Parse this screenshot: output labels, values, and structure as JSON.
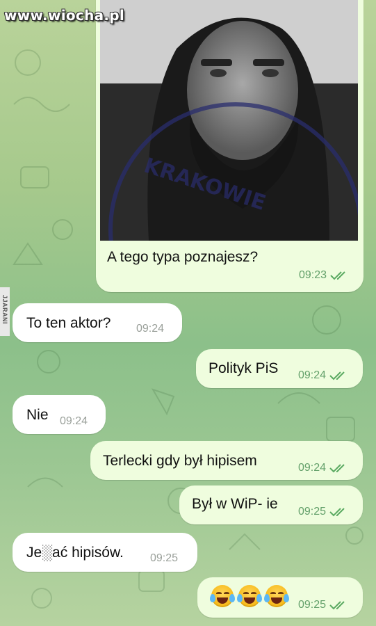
{
  "watermark": "www.wiocha.pl",
  "side_watermark": "JJARANI",
  "messages": [
    {
      "text": "A tego typa poznajesz?",
      "time": "09:23",
      "read": true
    },
    {
      "text": "To ten aktor?",
      "time": "09:24"
    },
    {
      "text": "Polityk PiS",
      "time": "09:24",
      "read": true
    },
    {
      "text": "Nie",
      "time": "09:24"
    },
    {
      "text": "Terlecki gdy był hipisem",
      "time": "09:24",
      "read": true
    },
    {
      "text": "Był w WiP- ie",
      "time": "09:25",
      "read": true
    },
    {
      "text": "Je░ać hipisów.",
      "time": "09:25"
    },
    {
      "text": "😂😂😂",
      "time": "09:25",
      "read": true
    }
  ],
  "photo": {
    "stamp_text": "KRAKOWIE"
  },
  "colors": {
    "outgoing": "#effdde",
    "incoming": "#ffffff",
    "time_out": "#63a06a",
    "check": "#5aaa61"
  },
  "icons": {
    "read_receipt": "double-check-icon",
    "emoji": "tears-of-joy-emoji"
  }
}
